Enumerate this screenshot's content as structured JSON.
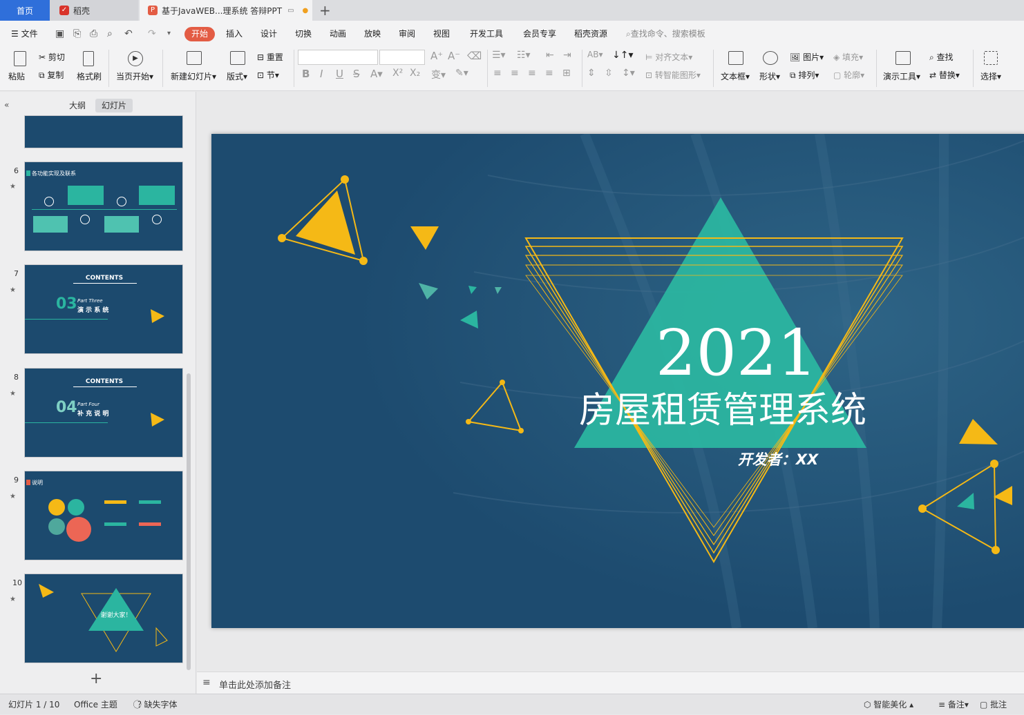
{
  "tabs": {
    "home": "首页",
    "daoke": "稻壳",
    "doc": "基于JavaWEB...理系统 答辩PPT"
  },
  "menu": {
    "file": "文件",
    "start": "开始",
    "items": [
      "插入",
      "设计",
      "切换",
      "动画",
      "放映",
      "审阅",
      "视图",
      "开发工具",
      "会员专享",
      "稻壳资源"
    ],
    "search_placeholder": "查找命令、搜索模板"
  },
  "ribbon": {
    "paste": "粘贴",
    "cut": "剪切",
    "copy": "复制",
    "format_painter": "格式刷",
    "play_from_current": "当页开始",
    "new_slide": "新建幻灯片",
    "layout": "版式",
    "reset": "重置",
    "section": "节",
    "align_text": "对齐文本",
    "smart_shape": "转智能图形",
    "textbox": "文本框",
    "shape": "形状",
    "picture": "图片",
    "arrange": "排列",
    "fill": "填充",
    "outline": "轮廓",
    "present_tools": "演示工具",
    "find": "查找",
    "replace": "替换",
    "select": "选择"
  },
  "panel": {
    "outline_tab": "大纲",
    "slides_tab": "幻灯片"
  },
  "thumbnails": [
    {
      "num": "6",
      "title": "各功能实现及联系"
    },
    {
      "num": "7",
      "contents": "CONTENTS",
      "part_num": "03",
      "part_en": "Part Three",
      "part_cn": "演 示 系 统"
    },
    {
      "num": "8",
      "contents": "CONTENTS",
      "part_num": "04",
      "part_en": "Part Four",
      "part_cn": "补 充 说 明"
    },
    {
      "num": "9",
      "title": "说明"
    },
    {
      "num": "10",
      "thanks": "谢谢大家！"
    }
  ],
  "slide": {
    "year": "2021",
    "title": "房屋租赁管理系统",
    "developer": "开发者：XX"
  },
  "notes": {
    "placeholder": "单击此处添加备注"
  },
  "status": {
    "slide_count": "幻灯片 1 / 10",
    "theme": "Office 主题",
    "missing_font": "缺失字体",
    "beautify": "智能美化",
    "notes": "备注",
    "comments": "批注"
  },
  "colors": {
    "slide_bg": "#1d4b6f",
    "teal": "#2bb5a0",
    "yellow": "#f5b916",
    "accent": "#e35c44"
  }
}
